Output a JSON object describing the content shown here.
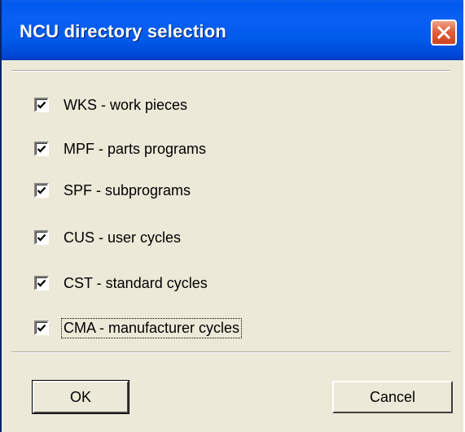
{
  "window": {
    "title": "NCU directory selection",
    "close_icon": "close-icon"
  },
  "options": [
    {
      "label": "WKS - work pieces",
      "checked": true
    },
    {
      "label": "MPF - parts programs",
      "checked": true
    },
    {
      "label": "SPF - subprograms",
      "checked": true
    },
    {
      "label": "CUS - user cycles",
      "checked": true
    },
    {
      "label": "CST - standard cycles",
      "checked": true
    },
    {
      "label": "CMA - manufacturer cycles",
      "checked": true
    }
  ],
  "buttons": {
    "ok_label": "OK",
    "cancel_label": "Cancel"
  }
}
